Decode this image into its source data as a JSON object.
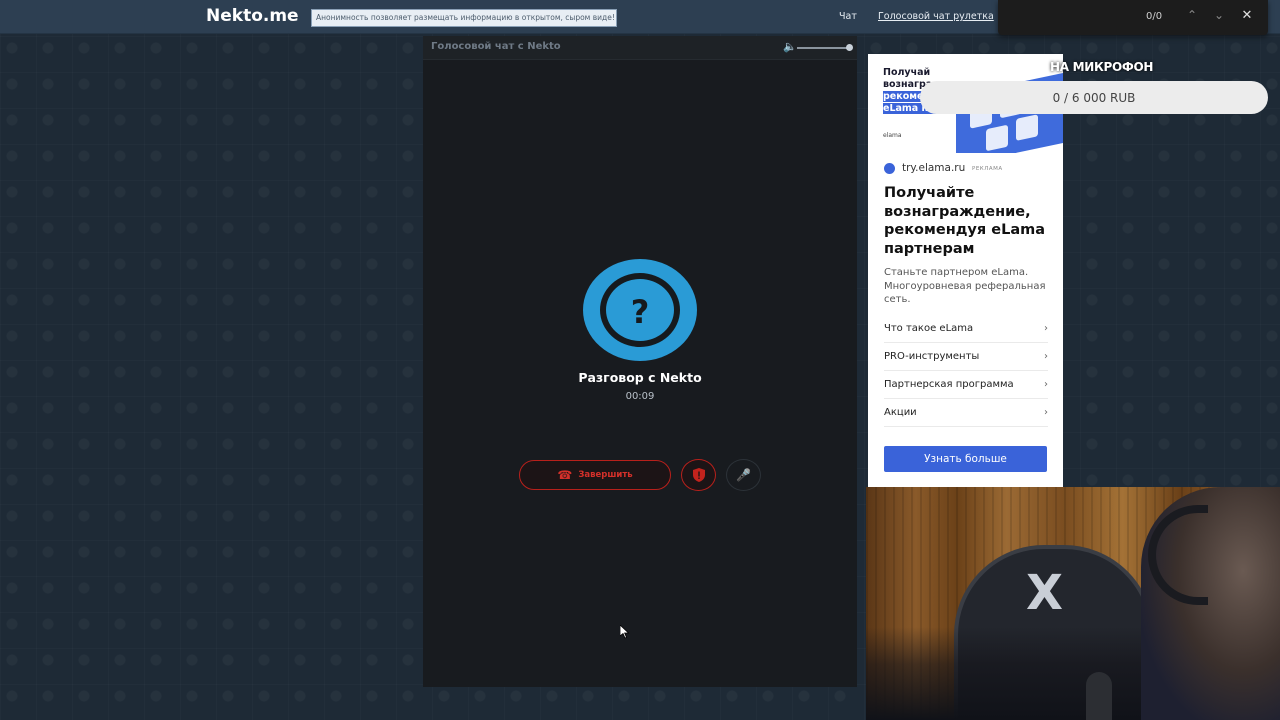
{
  "header": {
    "logo": "Nekto.me",
    "tagline": "Анонимность позволяет размещать информацию в открытом, сыром виде!",
    "nav_chat": "Чат",
    "nav_voice": "Голосовой чат рулетка"
  },
  "findbar": {
    "count": "0/0",
    "up_icon": "⌃",
    "down_icon": "⌄",
    "close_icon": "✕"
  },
  "chat": {
    "header_title": "Голосовой чат с Nekto",
    "volume_icon": "🔈",
    "avatar_symbol": "?",
    "call_title": "Разговор с Nekto",
    "timer": "00:09",
    "end_button_label": "Завершить",
    "phone_icon": "☎",
    "mic_icon": "🎤"
  },
  "ad": {
    "banner_text_before": "Получай вознаграждение, ",
    "banner_text_highlight": "рекомендуя eLama партнерам",
    "banner_logo": "elama",
    "source": "try.elama.ru",
    "tag": "РЕКЛАМА",
    "headline": "Получайте вознаграждение, рекомендуя eLama партнерам",
    "body": "Станьте партнером eLama. Многоуровневая реферальная сеть.",
    "links": [
      {
        "label": "Что такое eLama",
        "chevron": "›"
      },
      {
        "label": "PRO-инструменты",
        "chevron": "›"
      },
      {
        "label": "Партнерская программа",
        "chevron": "›"
      },
      {
        "label": "Акции",
        "chevron": "›"
      }
    ],
    "cta": "Узнать больше"
  },
  "donation": {
    "title": "НА МИКРОФОН",
    "progress_text": "0 / 6 000 RUB",
    "progress_fraction": 0
  },
  "webcam": {
    "chair_logo": "X"
  },
  "colors": {
    "accent_blue": "#2a9bd6",
    "end_red": "#d4302a",
    "ad_blue": "#3a63d9",
    "topbar": "#2d3f52"
  }
}
